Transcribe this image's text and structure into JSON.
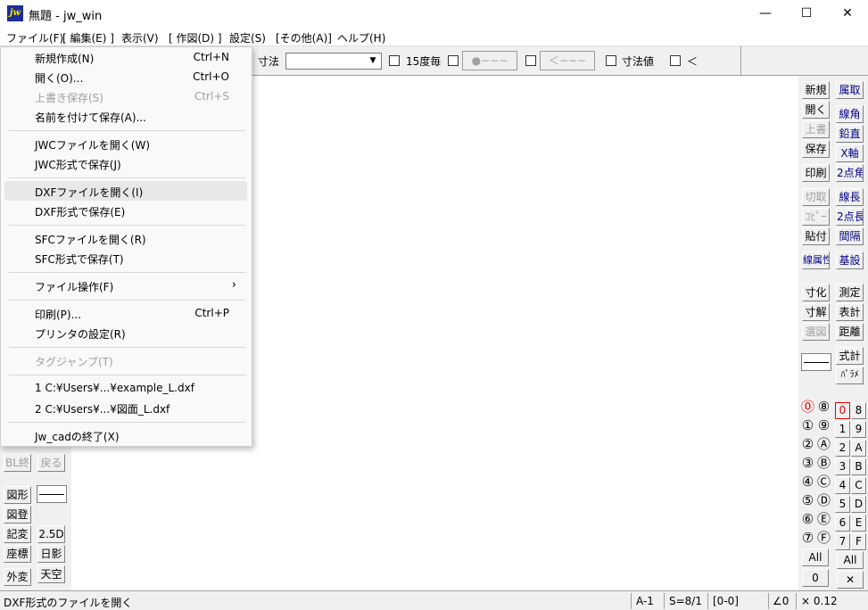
{
  "window": {
    "title": "無題 - jw_win",
    "icon_text": "jw",
    "minimize": "—",
    "maximize": "☐",
    "close": "✕"
  },
  "menubar": [
    "ファイル(F)",
    "[ 編集(E) ]",
    "表示(V)",
    "[ 作図(D) ]",
    "設定(S)",
    "[その他(A)]",
    "ヘルプ(H)"
  ],
  "toolbar": {
    "dim_label": "寸法",
    "dim_value": "",
    "every15": "15度毎",
    "btn_circle": "●−−−",
    "btn_arrow": "＜−−−",
    "dim_value_label": "寸法値",
    "lt": "＜"
  },
  "file_menu": {
    "items": [
      {
        "label": "新規作成(N)",
        "shortcut": "Ctrl+N"
      },
      {
        "label": "開く(O)...",
        "shortcut": "Ctrl+O"
      },
      {
        "label": "上書き保存(S)",
        "shortcut": "Ctrl+S"
      },
      {
        "label": "名前を付けて保存(A)...",
        "shortcut": ""
      },
      {
        "label": "JWCファイルを開く(W)",
        "shortcut": ""
      },
      {
        "label": "JWC形式で保存(J)",
        "shortcut": ""
      },
      {
        "label": "DXFファイルを開く(I)",
        "shortcut": ""
      },
      {
        "label": "DXF形式で保存(E)",
        "shortcut": ""
      },
      {
        "label": "SFCファイルを開く(R)",
        "shortcut": ""
      },
      {
        "label": "SFC形式で保存(T)",
        "shortcut": ""
      },
      {
        "label": "ファイル操作(F)",
        "shortcut": ""
      },
      {
        "label": "印刷(P)...",
        "shortcut": "Ctrl+P"
      },
      {
        "label": "プリンタの設定(R)",
        "shortcut": ""
      },
      {
        "label": "タグジャンプ(T)",
        "shortcut": ""
      },
      {
        "label": "1 C:¥Users¥...¥example_L.dxf",
        "shortcut": ""
      },
      {
        "label": "2 C:¥Users¥...¥図面_L.dxf",
        "shortcut": ""
      },
      {
        "label": "Jw_cadの終了(X)",
        "shortcut": ""
      }
    ],
    "submenu_arrow": "›"
  },
  "left_panel": {
    "bl_end": "BL終",
    "back": "戻る",
    "zukei": "図形",
    "zuto": "図登",
    "kihen": "記変",
    "zahyo": "座標",
    "gaihen": "外変",
    "d25": "2.5D",
    "hikage": "日影",
    "tenku": "天空"
  },
  "right_panel": {
    "col1_top": [
      "新規",
      "開く",
      "上書",
      "保存",
      "印刷",
      "切取",
      "ｺﾋﾟｰ",
      "貼付",
      "線属性"
    ],
    "col2_top": [
      "属取",
      "線角",
      "鉛直",
      "X軸",
      "2点角",
      "線長",
      "2点長",
      "間隔",
      "基設"
    ],
    "col1_mid": [
      "寸化",
      "寸解",
      "選図"
    ],
    "col2_mid": [
      "測定",
      "表計",
      "距離",
      "式計",
      "ﾊﾟﾗﾒ"
    ],
    "write_layers_a": [
      "⓪",
      "①",
      "②",
      "③",
      "④",
      "⑤",
      "⑥",
      "⑦"
    ],
    "write_layers_b": [
      "⑧",
      "⑨",
      "Ⓐ",
      "Ⓑ",
      "Ⓒ",
      "Ⓓ",
      "Ⓔ",
      "Ⓕ"
    ],
    "groups_a": [
      "0",
      "1",
      "2",
      "3",
      "4",
      "5",
      "6",
      "7"
    ],
    "groups_b": [
      "8",
      "9",
      "A",
      "B",
      "C",
      "D",
      "E",
      "F"
    ],
    "all": "All",
    "zero": "0",
    "x": "✕"
  },
  "statusbar": {
    "message": "DXF形式のファイルを開く",
    "paper": "A-1",
    "scale": "S=8/1",
    "layer": "[0-0]",
    "angle": "∠0",
    "factor": "× 0.12"
  }
}
